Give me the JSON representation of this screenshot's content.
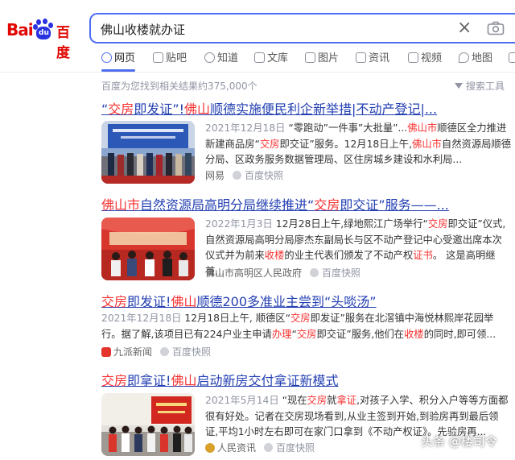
{
  "logo": {
    "bai": "Bai",
    "du": "du",
    "cn": "百度"
  },
  "search": {
    "query": "佛山收楼就办证"
  },
  "tabs": [
    {
      "label": "网页",
      "icon": "search-icon"
    },
    {
      "label": "贴吧",
      "icon": "tieba-icon"
    },
    {
      "label": "知道",
      "icon": "question-icon"
    },
    {
      "label": "文库",
      "icon": "document-icon"
    },
    {
      "label": "图片",
      "icon": "image-icon"
    },
    {
      "label": "资讯",
      "icon": "news-icon"
    },
    {
      "label": "视频",
      "icon": "video-icon"
    },
    {
      "label": "地图",
      "icon": "map-icon"
    }
  ],
  "result_count": "百度为您找到相关结果约375,000个",
  "tools_label": "搜索工具",
  "results": [
    {
      "title": [
        {
          "t": "“",
          "hl": false
        },
        {
          "t": "交房",
          "hl": true
        },
        {
          "t": "即发证”!",
          "hl": false
        },
        {
          "t": "佛山",
          "hl": true
        },
        {
          "t": "顺德实施便民利企新举措|不动产登记|...",
          "hl": false
        }
      ],
      "snippet": [
        {
          "t": "2021年12月18日",
          "c": "date"
        },
        {
          "t": " “零跑动”一件事”大批量”...",
          "c": ""
        },
        {
          "t": "佛山市",
          "c": "hl"
        },
        {
          "t": "顺德区全力推进新建商品房“",
          "c": ""
        },
        {
          "t": "交房",
          "c": "hl"
        },
        {
          "t": "即交证”服务。12月18日上午,",
          "c": ""
        },
        {
          "t": "佛山市",
          "c": "hl"
        },
        {
          "t": "自然资源局顺德分局、区政务服务数据管理局、区住房城乡建设和水利局...",
          "c": ""
        }
      ],
      "source": "网易",
      "snapshot": "百度快照"
    },
    {
      "title": [
        {
          "t": "佛山市",
          "hl": true
        },
        {
          "t": "自然资源局高明分局继续推进“",
          "hl": false
        },
        {
          "t": "交房",
          "hl": true
        },
        {
          "t": "即交证”服务——...",
          "hl": false
        }
      ],
      "snippet": [
        {
          "t": "2022年1月3日",
          "c": "date"
        },
        {
          "t": " 12月28日上午,绿地熙江广场举行“",
          "c": ""
        },
        {
          "t": "交房",
          "c": "hl"
        },
        {
          "t": "即交证”仪式,自然资源局高明分局廖杰东副局长与区不动产登记中心受邀出席本次仪式并为前来",
          "c": ""
        },
        {
          "t": "收楼",
          "c": "hl"
        },
        {
          "t": "的业主代表们颁发了不动产权",
          "c": ""
        },
        {
          "t": "证书",
          "c": "hl"
        },
        {
          "t": "。 这是高明继首...",
          "c": ""
        }
      ],
      "source": "佛山市高明区人民政府",
      "snapshot": "百度快照"
    },
    {
      "title": [
        {
          "t": "交房",
          "hl": true
        },
        {
          "t": "即发证!",
          "hl": false
        },
        {
          "t": "佛山",
          "hl": true
        },
        {
          "t": "顺德200多准业主尝到“头啖汤”",
          "hl": false
        }
      ],
      "snippet": [
        {
          "t": "2021年12月18日",
          "c": "date"
        },
        {
          "t": " 12月18日上午, 顺德区“",
          "c": ""
        },
        {
          "t": "交房",
          "c": "hl"
        },
        {
          "t": "即发证”服务在北滘镇中海悦林熙岸花园举行。据了解,该项目已有224户业主申请",
          "c": ""
        },
        {
          "t": "办理",
          "c": "hl"
        },
        {
          "t": "“",
          "c": ""
        },
        {
          "t": "交房",
          "c": "hl"
        },
        {
          "t": "即交证”服务,他们在",
          "c": ""
        },
        {
          "t": "收楼",
          "c": "hl"
        },
        {
          "t": "的同时,即可领...",
          "c": ""
        }
      ],
      "source": "九派新闻",
      "snapshot": "百度快照"
    },
    {
      "title": [
        {
          "t": "交房",
          "hl": true
        },
        {
          "t": "即拿证!",
          "hl": false
        },
        {
          "t": "佛山",
          "hl": true
        },
        {
          "t": "启动新房交付拿证新模式",
          "hl": false
        }
      ],
      "snippet": [
        {
          "t": "2021年5月14日",
          "c": "date"
        },
        {
          "t": " “现在",
          "c": ""
        },
        {
          "t": "交房",
          "c": "hl"
        },
        {
          "t": "就",
          "c": ""
        },
        {
          "t": "拿证",
          "c": "hl"
        },
        {
          "t": ",对孩子入学、积分入户等等方面都很有好处。记者在交房现场看到,从业主签到开始,到验房再到最后领证,平均1小时左右即可在家门口拿到《不动产权证》。先验房再...",
          "c": ""
        }
      ],
      "source": "人民资讯",
      "snapshot": "百度快照"
    }
  ],
  "watermark": "头条 @楼司令",
  "colors": {
    "brand_red": "#e10601",
    "brand_blue": "#2932e1",
    "link": "#2440b3",
    "highlight": "#f73131",
    "accent": "#4e6ef2"
  }
}
